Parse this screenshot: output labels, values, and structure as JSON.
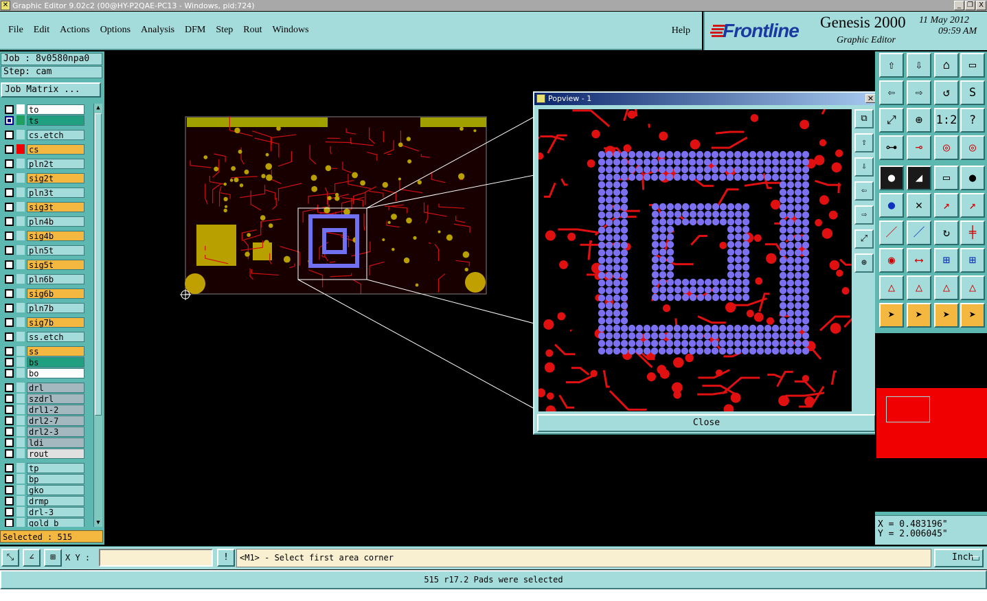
{
  "window": {
    "title": "Graphic Editor 9.02c2 (00@HY-P2QAE-PC13 - Windows, pid:724)",
    "controls": [
      "_",
      "❐",
      "X"
    ]
  },
  "menu": {
    "file": "File",
    "edit": "Edit",
    "actions": "Actions",
    "options": "Options",
    "analysis": "Analysis",
    "dfm": "DFM",
    "step": "Step",
    "rout": "Rout",
    "windows": "Windows",
    "help": "Help"
  },
  "brand": {
    "logo": "Frontline",
    "product": "Genesis 2000",
    "subtitle": "Graphic Editor",
    "date": "11 May 2012",
    "time": "09:59 AM"
  },
  "job": {
    "job_label": "Job : 8v0580npa0",
    "step_label": "Step: cam",
    "matrix_button": "Job Matrix ..."
  },
  "layers": [
    {
      "name": "to",
      "color": "#ffffff",
      "checked": false,
      "fill": "#ffffff"
    },
    {
      "name": "ts",
      "color": "#20a060",
      "checked": true,
      "fill": "#20a080"
    },
    {
      "name": "cs.etch",
      "color": "#a4dcdc",
      "checked": false,
      "fill": "#a4dcdc"
    },
    {
      "name": "cs",
      "color": "#f00000",
      "checked": false,
      "fill": "#f4b840"
    },
    {
      "name": "pln2t",
      "color": "#a4dcdc",
      "checked": false,
      "fill": "#a4dcdc"
    },
    {
      "name": "sig2t",
      "color": "#a4dcdc",
      "checked": false,
      "fill": "#f4b840"
    },
    {
      "name": "pln3t",
      "color": "#a4dcdc",
      "checked": false,
      "fill": "#a4dcdc"
    },
    {
      "name": "sig3t",
      "color": "#a4dcdc",
      "checked": false,
      "fill": "#f4b840"
    },
    {
      "name": "pln4b",
      "color": "#a4dcdc",
      "checked": false,
      "fill": "#a4dcdc"
    },
    {
      "name": "sig4b",
      "color": "#a4dcdc",
      "checked": false,
      "fill": "#f4b840"
    },
    {
      "name": "pln5t",
      "color": "#a4dcdc",
      "checked": false,
      "fill": "#a4dcdc"
    },
    {
      "name": "sig5t",
      "color": "#a4dcdc",
      "checked": false,
      "fill": "#f4b840"
    },
    {
      "name": "pln6b",
      "color": "#a4dcdc",
      "checked": false,
      "fill": "#a4dcdc"
    },
    {
      "name": "sig6b",
      "color": "#a4dcdc",
      "checked": false,
      "fill": "#f4b840"
    },
    {
      "name": "pln7b",
      "color": "#a4dcdc",
      "checked": false,
      "fill": "#a4dcdc"
    },
    {
      "name": "sig7b",
      "color": "#a4dcdc",
      "checked": false,
      "fill": "#f4b840"
    },
    {
      "name": "ss.etch",
      "color": "#a4dcdc",
      "checked": false,
      "fill": "#a4dcdc"
    },
    {
      "name": "ss",
      "color": "#a4dcdc",
      "checked": false,
      "fill": "#f4b840"
    },
    {
      "name": "bs",
      "color": "#a4dcdc",
      "checked": false,
      "fill": "#20a080"
    },
    {
      "name": "bo",
      "color": "#a4dcdc",
      "checked": false,
      "fill": "#ffffff"
    },
    {
      "name": "drl",
      "color": "#a4dcdc",
      "checked": false,
      "fill": "#a4b8c0"
    },
    {
      "name": "szdrl",
      "color": "#a4dcdc",
      "checked": false,
      "fill": "#a4b8c0"
    },
    {
      "name": "drl1-2",
      "color": "#a4dcdc",
      "checked": false,
      "fill": "#a4b8c0"
    },
    {
      "name": "drl2-7",
      "color": "#a4dcdc",
      "checked": false,
      "fill": "#a4b8c0"
    },
    {
      "name": "drl2-3",
      "color": "#a4dcdc",
      "checked": false,
      "fill": "#a4b8c0"
    },
    {
      "name": "ldi",
      "color": "#a4dcdc",
      "checked": false,
      "fill": "#a4b8c0"
    },
    {
      "name": "rout",
      "color": "#a4dcdc",
      "checked": false,
      "fill": "#e0e0e0"
    },
    {
      "name": "tp",
      "color": "#a4dcdc",
      "checked": false,
      "fill": "#a4dcdc"
    },
    {
      "name": "bp",
      "color": "#a4dcdc",
      "checked": false,
      "fill": "#a4dcdc"
    },
    {
      "name": "gko",
      "color": "#a4dcdc",
      "checked": false,
      "fill": "#a4dcdc"
    },
    {
      "name": "drmp",
      "color": "#a4dcdc",
      "checked": false,
      "fill": "#a4dcdc"
    },
    {
      "name": "drl-3",
      "color": "#a4dcdc",
      "checked": false,
      "fill": "#a4dcdc"
    },
    {
      "name": "gold_b",
      "color": "#a4dcdc",
      "checked": false,
      "fill": "#a4dcdc"
    }
  ],
  "selected": "Selected : 515",
  "popview": {
    "title": "Popview - 1",
    "close_label": "Close",
    "tools": [
      "⧉",
      "⇧",
      "⇩",
      "⇦",
      "⇨",
      "⤢",
      "⊕"
    ]
  },
  "tools": [
    "⇧",
    "⇩",
    "⌂",
    "▭",
    "⇦",
    "⇨",
    "↺",
    "S",
    "⤢",
    "⊕",
    "1:2",
    "?",
    "⊶",
    "⊸",
    "◎",
    "◎",
    "●",
    "◢",
    "▭",
    "●",
    "●",
    "✕",
    "↗",
    "↗",
    "／",
    "／",
    "↻",
    "╪",
    "◉",
    "⟷",
    "⊞",
    "⊞",
    "△",
    "△",
    "△",
    "△",
    "➤",
    "➤",
    "➤",
    "➤"
  ],
  "coords": {
    "x": "X = 0.483196\"",
    "y": "Y = 2.006045\""
  },
  "bottom": {
    "xy_label": "X Y :",
    "xy_value": "",
    "prompt": "<M1> - Select first area corner",
    "unit": "Inch",
    "status": "515 r17.2 Pads were selected"
  }
}
